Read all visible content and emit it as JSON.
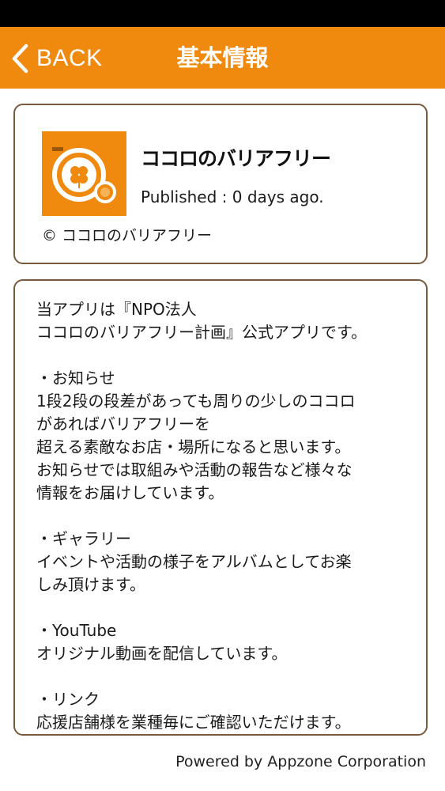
{
  "nav": {
    "back_label": "BACK",
    "title": "基本情報",
    "bar_color": "#f08a0f"
  },
  "app": {
    "name": "ココロのバリアフリー",
    "published": "Published : 0 days ago.",
    "copyright": "© ココロのバリアフリー",
    "icon": "clover-logo-icon"
  },
  "description": {
    "lines": [
      "当アプリは『NPO法人",
      "ココロのバリアフリー計画』公式アプリです。",
      "",
      "・お知らせ",
      "1段2段の段差があっても周りの少しのココロ",
      "があればバリアフリーを",
      "超える素敵なお店・場所になると思います。",
      "お知らせでは取組みや活動の報告など様々な",
      "情報をお届けしています。",
      "",
      "・ギャラリー",
      "イベントや活動の様子をアルバムとしてお楽",
      "しみ頂けます。",
      "",
      "・YouTube",
      "オリジナル動画を配信しています。",
      "",
      "・リンク",
      "応援店舗様を業種毎にご確認いただけます。"
    ]
  },
  "footer": {
    "text": "Powered by Appzone Corporation"
  }
}
